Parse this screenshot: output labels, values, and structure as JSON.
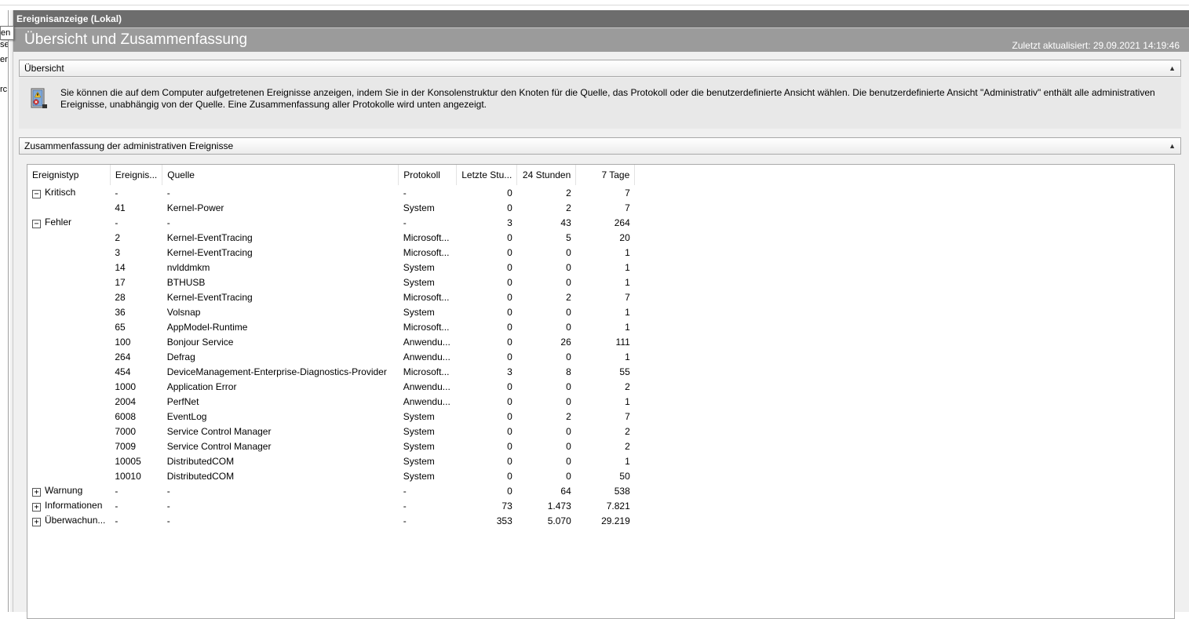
{
  "left_pane": {
    "fragments": [
      "en",
      "se",
      "er",
      "rc"
    ]
  },
  "window": {
    "title": "Ereignisanzeige (Lokal)",
    "heading": "Übersicht und Zusammenfassung",
    "last_updated": "Zuletzt aktualisiert: 29.09.2021 14:19:46"
  },
  "overview": {
    "header": "Übersicht",
    "collapse_glyph": "▲",
    "text": "Sie können die auf dem Computer aufgetretenen Ereignisse anzeigen, indem Sie in der Konsolenstruktur den Knoten für die Quelle, das Protokoll oder die benutzerdefinierte Ansicht wählen. Die benutzerdefinierte Ansicht \"Administrativ\" enthält alle administrativen Ereignisse, unabhängig von der Quelle. Eine Zusammenfassung aller Protokolle wird unten angezeigt."
  },
  "summary": {
    "header": "Zusammenfassung der administrativen Ereignisse",
    "collapse_glyph": "▲",
    "columns": [
      "Ereignistyp",
      "Ereignis...",
      "Quelle",
      "Protokoll",
      "Letzte Stu...",
      "24 Stunden",
      "7 Tage"
    ],
    "rows": [
      {
        "expander": "−",
        "type": "Kritisch",
        "id": "-",
        "source": "-",
        "log": "-",
        "hour": "0",
        "day": "2",
        "week": "7"
      },
      {
        "expander": "",
        "type": "",
        "id": "41",
        "source": "Kernel-Power",
        "log": "System",
        "hour": "0",
        "day": "2",
        "week": "7"
      },
      {
        "expander": "−",
        "type": "Fehler",
        "id": "-",
        "source": "-",
        "log": "-",
        "hour": "3",
        "day": "43",
        "week": "264"
      },
      {
        "expander": "",
        "type": "",
        "id": "2",
        "source": "Kernel-EventTracing",
        "log": "Microsoft...",
        "hour": "0",
        "day": "5",
        "week": "20"
      },
      {
        "expander": "",
        "type": "",
        "id": "3",
        "source": "Kernel-EventTracing",
        "log": "Microsoft...",
        "hour": "0",
        "day": "0",
        "week": "1"
      },
      {
        "expander": "",
        "type": "",
        "id": "14",
        "source": "nvlddmkm",
        "log": "System",
        "hour": "0",
        "day": "0",
        "week": "1"
      },
      {
        "expander": "",
        "type": "",
        "id": "17",
        "source": "BTHUSB",
        "log": "System",
        "hour": "0",
        "day": "0",
        "week": "1"
      },
      {
        "expander": "",
        "type": "",
        "id": "28",
        "source": "Kernel-EventTracing",
        "log": "Microsoft...",
        "hour": "0",
        "day": "2",
        "week": "7"
      },
      {
        "expander": "",
        "type": "",
        "id": "36",
        "source": "Volsnap",
        "log": "System",
        "hour": "0",
        "day": "0",
        "week": "1"
      },
      {
        "expander": "",
        "type": "",
        "id": "65",
        "source": "AppModel-Runtime",
        "log": "Microsoft...",
        "hour": "0",
        "day": "0",
        "week": "1"
      },
      {
        "expander": "",
        "type": "",
        "id": "100",
        "source": "Bonjour Service",
        "log": "Anwendu...",
        "hour": "0",
        "day": "26",
        "week": "111"
      },
      {
        "expander": "",
        "type": "",
        "id": "264",
        "source": "Defrag",
        "log": "Anwendu...",
        "hour": "0",
        "day": "0",
        "week": "1"
      },
      {
        "expander": "",
        "type": "",
        "id": "454",
        "source": "DeviceManagement-Enterprise-Diagnostics-Provider",
        "log": "Microsoft...",
        "hour": "3",
        "day": "8",
        "week": "55"
      },
      {
        "expander": "",
        "type": "",
        "id": "1000",
        "source": "Application Error",
        "log": "Anwendu...",
        "hour": "0",
        "day": "0",
        "week": "2"
      },
      {
        "expander": "",
        "type": "",
        "id": "2004",
        "source": "PerfNet",
        "log": "Anwendu...",
        "hour": "0",
        "day": "0",
        "week": "1"
      },
      {
        "expander": "",
        "type": "",
        "id": "6008",
        "source": "EventLog",
        "log": "System",
        "hour": "0",
        "day": "2",
        "week": "7"
      },
      {
        "expander": "",
        "type": "",
        "id": "7000",
        "source": "Service Control Manager",
        "log": "System",
        "hour": "0",
        "day": "0",
        "week": "2"
      },
      {
        "expander": "",
        "type": "",
        "id": "7009",
        "source": "Service Control Manager",
        "log": "System",
        "hour": "0",
        "day": "0",
        "week": "2"
      },
      {
        "expander": "",
        "type": "",
        "id": "10005",
        "source": "DistributedCOM",
        "log": "System",
        "hour": "0",
        "day": "0",
        "week": "1"
      },
      {
        "expander": "",
        "type": "",
        "id": "10010",
        "source": "DistributedCOM",
        "log": "System",
        "hour": "0",
        "day": "0",
        "week": "50"
      },
      {
        "expander": "+",
        "type": "Warnung",
        "id": "-",
        "source": "-",
        "log": "-",
        "hour": "0",
        "day": "64",
        "week": "538"
      },
      {
        "expander": "+",
        "type": "Informationen",
        "id": "-",
        "source": "-",
        "log": "-",
        "hour": "73",
        "day": "1.473",
        "week": "7.821"
      },
      {
        "expander": "+",
        "type": "Überwachun...",
        "id": "-",
        "source": "-",
        "log": "-",
        "hour": "353",
        "day": "5.070",
        "week": "29.219"
      }
    ]
  }
}
